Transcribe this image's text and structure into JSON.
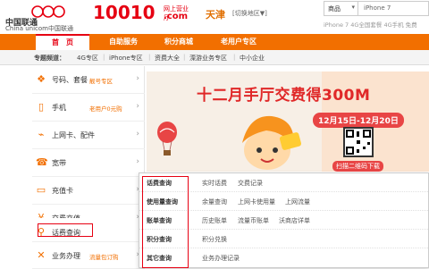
{
  "header": {
    "logo_cn": "中国联通",
    "logo_en": "China unicom中国联通",
    "brand_number": "10010",
    "brand_sub": "网上营业厅",
    "brand_com": ".com",
    "city": "天津",
    "city_switch": "[切换地区▼]",
    "search": {
      "category": "商品",
      "value": "iPhone 7"
    },
    "hot_words": "iPhone 7  4G全国套餐  4G手机  免费"
  },
  "nav": {
    "items": [
      "首　页",
      "自助服务",
      "积分商城",
      "老用户专区"
    ]
  },
  "subnav": {
    "label": "专题频道：",
    "links": [
      "4G专区",
      "iPhone专区",
      "资费大全",
      "溧游业务专区",
      "中小企业"
    ]
  },
  "sidebar": {
    "items": [
      {
        "label": "号码、套餐",
        "tag": "靓号专区",
        "icon": "cube-icon"
      },
      {
        "label": "手机",
        "tag": "老用户0元购",
        "icon": "phone-icon"
      },
      {
        "label": "上网卡、配件",
        "tag": "",
        "icon": "usb-icon"
      },
      {
        "label": "宽带",
        "tag": "",
        "icon": "broadband-icon"
      },
      {
        "label": "充值卡",
        "tag": "",
        "icon": "card-icon"
      },
      {
        "label": "交费充值",
        "tag": "",
        "icon": "yen-icon"
      },
      {
        "label": "话费查询",
        "tag": "",
        "icon": "query-icon"
      },
      {
        "label": "业务办理",
        "tag": "流量包订购",
        "icon": "wrench-icon"
      }
    ]
  },
  "banner": {
    "title": "十二月手厅交费得300M",
    "date": "12月15日-12月20日",
    "qr_label": "扫描二维码下载"
  },
  "dropdown": {
    "rows": [
      {
        "category": "话费查询",
        "links": [
          "实时话费",
          "交费记录"
        ]
      },
      {
        "category": "使用量查询",
        "links": [
          "余量查询",
          "上网卡使用量",
          "上网流量"
        ]
      },
      {
        "category": "账单查询",
        "links": [
          "历史账单",
          "流量币账单",
          "沃商店详单"
        ]
      },
      {
        "category": "积分查询",
        "links": [
          "积分兑换"
        ]
      },
      {
        "category": "其它查询",
        "links": [
          "业务办理记录"
        ]
      }
    ]
  },
  "colors": {
    "accent": "#f26f00",
    "brand_red": "#e60012",
    "banner_red": "#e02828"
  }
}
